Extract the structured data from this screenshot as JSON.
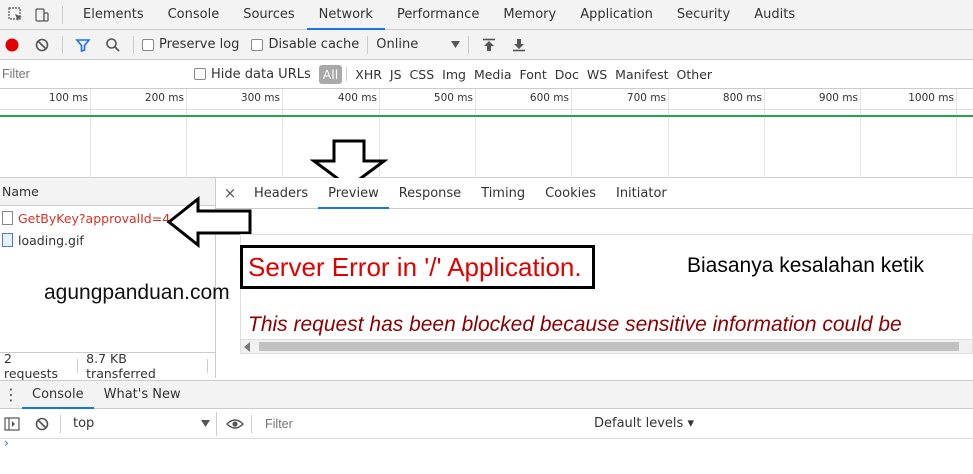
{
  "main_tabs": [
    "Elements",
    "Console",
    "Sources",
    "Network",
    "Performance",
    "Memory",
    "Application",
    "Security",
    "Audits"
  ],
  "active_main_tab": "Network",
  "toolbar": {
    "preserve_log": "Preserve log",
    "disable_cache": "Disable cache",
    "throttle": "Online"
  },
  "filter_bar": {
    "filter_placeholder": "Filter",
    "hide_data_urls": "Hide data URLs",
    "types": [
      "All",
      "XHR",
      "JS",
      "CSS",
      "Img",
      "Media",
      "Font",
      "Doc",
      "WS",
      "Manifest",
      "Other"
    ]
  },
  "timeline": {
    "ticks": [
      "100 ms",
      "200 ms",
      "300 ms",
      "400 ms",
      "500 ms",
      "600 ms",
      "700 ms",
      "800 ms",
      "900 ms",
      "1000 ms"
    ]
  },
  "request_list": {
    "header": "Name",
    "items": [
      {
        "name": "GetByKey?approvalId=4",
        "status": "error"
      },
      {
        "name": "loading.gif",
        "status": "ok"
      }
    ],
    "summary_requests": "2 requests",
    "summary_transferred": "8.7 KB transferred"
  },
  "detail_tabs": [
    "Headers",
    "Preview",
    "Response",
    "Timing",
    "Cookies",
    "Initiator"
  ],
  "active_detail_tab": "Preview",
  "preview": {
    "error_title": "Server Error in '/' Application.",
    "annotation": "Biasanya kesalahan ketik",
    "message": "This request has been blocked because sensitive information could be"
  },
  "watermark": "agungpanduan.com",
  "drawer": {
    "tabs": [
      "Console",
      "What's New"
    ],
    "context": "top",
    "filter_placeholder": "Filter",
    "levels": "Default levels ▾"
  },
  "colors": {
    "accent": "#1a73e8",
    "record": "#e00000",
    "error_text": "#d93025",
    "timeline_bar": "#2ca54a"
  }
}
